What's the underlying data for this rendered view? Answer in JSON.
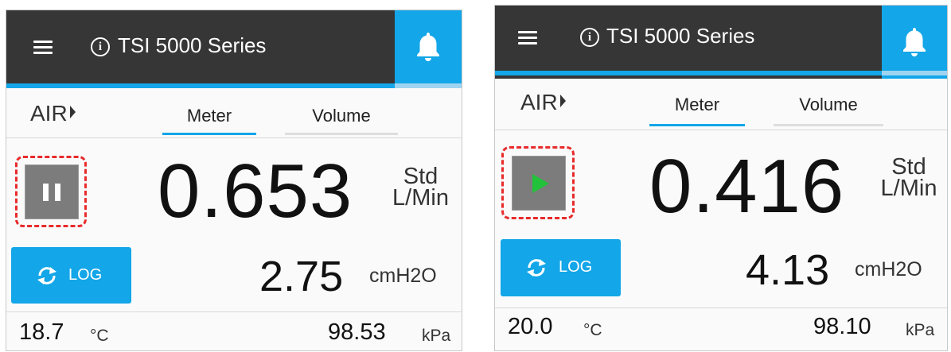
{
  "panels": [
    {
      "title": "TSI 5000 Series",
      "mode": "AIR",
      "tabs": [
        {
          "label": "Meter",
          "active": true
        },
        {
          "label": "Volume",
          "active": false
        }
      ],
      "control_state": "paused",
      "control_icon": "pause-icon",
      "flow": {
        "value": "0.653",
        "unit_line1": "Std",
        "unit_line2": "L/Min"
      },
      "pressure": {
        "value": "2.75",
        "unit": "cmH2O"
      },
      "log_label": "LOG",
      "temperature": {
        "value": "18.7",
        "unit": "°C"
      },
      "barometric": {
        "value": "98.53",
        "unit": "kPa"
      }
    },
    {
      "title": "TSI 5000 Series",
      "mode": "AIR",
      "tabs": [
        {
          "label": "Meter",
          "active": true
        },
        {
          "label": "Volume",
          "active": false
        }
      ],
      "control_state": "running",
      "control_icon": "play-icon",
      "flow": {
        "value": "0.416",
        "unit_line1": "Std",
        "unit_line2": "L/Min"
      },
      "pressure": {
        "value": "4.13",
        "unit": "cmH2O"
      },
      "log_label": "LOG",
      "temperature": {
        "value": "20.0",
        "unit": "°C"
      },
      "barometric": {
        "value": "98.10",
        "unit": "kPa"
      }
    }
  ],
  "colors": {
    "topbar": "#363636",
    "accent": "#13a6e8",
    "highlight": "#e82b2b",
    "play": "#22c23a"
  }
}
